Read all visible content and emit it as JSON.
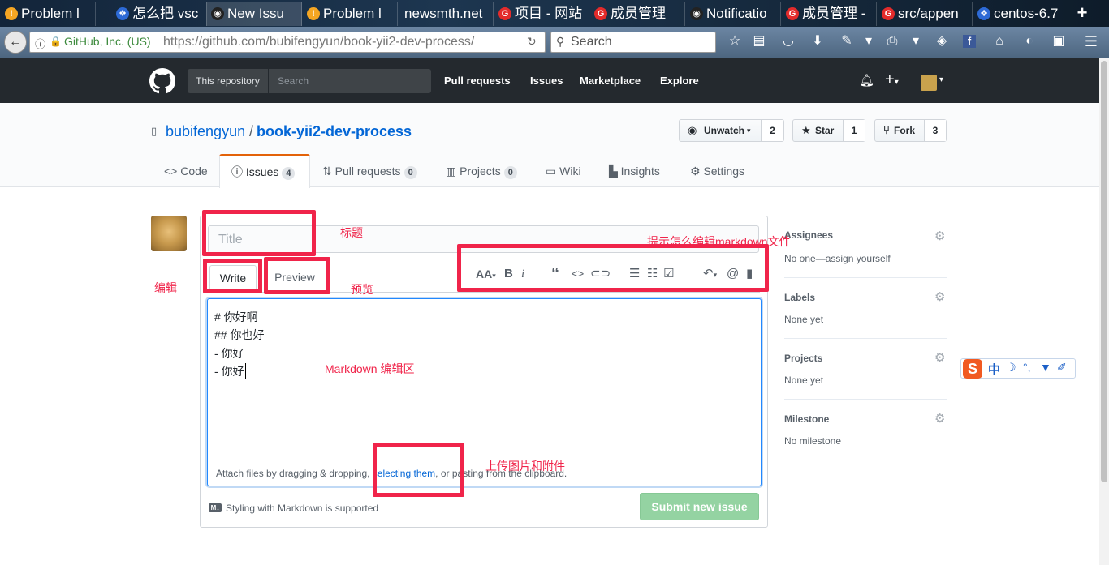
{
  "browser": {
    "tabs": [
      {
        "label": "Problem l",
        "icon_color": "#f5a623",
        "icon": "!"
      },
      {
        "label": "怎么把 vsc",
        "icon_color": "#2d6ad6",
        "icon": "❖"
      },
      {
        "label": "New Issu",
        "icon_color": "#222222",
        "icon": "◉"
      },
      {
        "label": "Problem l",
        "icon_color": "#f5a623",
        "icon": "!"
      },
      {
        "label": "newsmth.net",
        "icon_color": "",
        "icon": ""
      },
      {
        "label": "项目 - 网站",
        "icon_color": "#e32b2b",
        "icon": "G"
      },
      {
        "label": "成员管理",
        "icon_color": "#e32b2b",
        "icon": "G"
      },
      {
        "label": "Notificatio",
        "icon_color": "#222222",
        "icon": "◉"
      },
      {
        "label": "成员管理 -",
        "icon_color": "#e32b2b",
        "icon": "G"
      },
      {
        "label": "src/appen",
        "icon_color": "#e32b2b",
        "icon": "G"
      },
      {
        "label": "centos-6.7",
        "icon_color": "#2d6ad6",
        "icon": "❖"
      }
    ],
    "new_tab": "+",
    "site_identity": "GitHub, Inc. (US)",
    "url": "https://github.com/bubifengyun/book-yii2-dev-process/",
    "search_placeholder": "Search"
  },
  "header": {
    "scope": "This repository",
    "search_placeholder": "Search",
    "nav": [
      "Pull requests",
      "Issues",
      "Marketplace",
      "Explore"
    ]
  },
  "repo": {
    "owner": "bubifengyun",
    "sep": "/",
    "name": "book-yii2-dev-process",
    "actions": [
      {
        "label": "Unwatch",
        "count": "2"
      },
      {
        "label": "Star",
        "count": "1"
      },
      {
        "label": "Fork",
        "count": "3"
      }
    ],
    "tabs": [
      {
        "label": "Code",
        "count": ""
      },
      {
        "label": "Issues",
        "count": "4"
      },
      {
        "label": "Pull requests",
        "count": "0"
      },
      {
        "label": "Projects",
        "count": "0"
      },
      {
        "label": "Wiki",
        "count": ""
      },
      {
        "label": "Insights",
        "count": ""
      },
      {
        "label": "Settings",
        "count": ""
      }
    ]
  },
  "issue_form": {
    "title_placeholder": "Title",
    "write_tab": "Write",
    "preview_tab": "Preview",
    "body_lines": [
      "# 你好啊",
      "## 你也好",
      "- 你好",
      "- 你好"
    ],
    "attach_prefix": "Attach files by dragging & dropping, ",
    "attach_link": "selecting them",
    "attach_suffix": ", or pasting from the clipboard.",
    "markdown_note": "Styling with Markdown is supported",
    "submit": "Submit new issue"
  },
  "sidebar": [
    {
      "heading": "Assignees",
      "value": "No one—assign yourself"
    },
    {
      "heading": "Labels",
      "value": "None yet"
    },
    {
      "heading": "Projects",
      "value": "None yet"
    },
    {
      "heading": "Milestone",
      "value": "No milestone"
    }
  ],
  "annotations": {
    "title": "标题",
    "toolbar_hint": "提示怎么编辑markdown文件",
    "edit": "编辑",
    "preview": "预览",
    "editor_area": "Markdown 编辑区",
    "upload": "上传图片和附件"
  },
  "ime": {
    "label": "中"
  },
  "colors": {
    "github_dark": "#24292e",
    "link_blue": "#0366d6",
    "annotation_red": "#f0244a",
    "submit_green": "#94d3a2",
    "tab_accent": "#e36209"
  }
}
